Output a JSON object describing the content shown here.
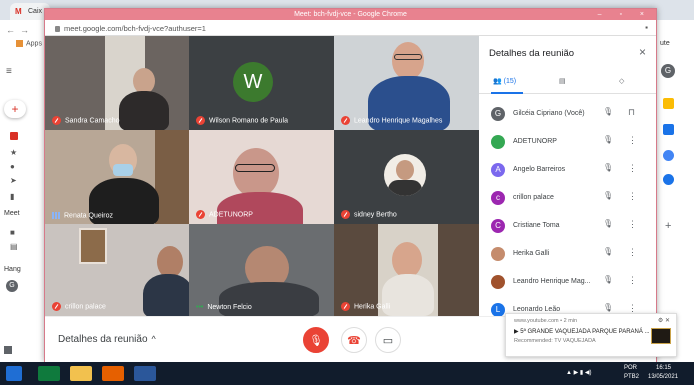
{
  "browser_bg": {
    "tab_label": "Caix",
    "apps_label": "Apps"
  },
  "window": {
    "title": "Meet: bch-fvdj-vce - Google Chrome",
    "url": "meet.google.com/bch-fvdj-vce?authuser=1",
    "controls": "– ▫ ×"
  },
  "tiles": [
    {
      "name": "Sandra Camacho",
      "status": "muted"
    },
    {
      "name": "Wilson Romano de Paula",
      "status": "muted",
      "avatar_letter": "W"
    },
    {
      "name": "Leandro Henrique Magalhes",
      "status": "muted"
    },
    {
      "name": "Renata Queiroz",
      "status": "speaking"
    },
    {
      "name": "ADETUNORP",
      "status": "muted"
    },
    {
      "name": "sidney Bertho",
      "status": "muted"
    },
    {
      "name": "crillon palace",
      "status": "muted"
    },
    {
      "name": "Newton Felcio",
      "status": "dots"
    },
    {
      "name": "Herika Galli",
      "status": "muted"
    }
  ],
  "bottom_bar": {
    "details_label": "Detalhes da reunião",
    "details_chevron": "^"
  },
  "panel": {
    "title": "Detalhes da reunião",
    "close": "×",
    "people_count": "(15)",
    "participants": [
      {
        "name": "Gilcéia Cipriano (Você)",
        "avatar": "G",
        "color": "#5f6368"
      },
      {
        "name": "ADETUNORP",
        "avatar": "",
        "color": "#34a853"
      },
      {
        "name": "Angelo Barreiros",
        "avatar": "A",
        "color": "#7b68ee"
      },
      {
        "name": "crillon palace",
        "avatar": "c",
        "color": "#9c27b0"
      },
      {
        "name": "Cristiane Toma",
        "avatar": "C",
        "color": "#9c27b0"
      },
      {
        "name": "Herika Galli",
        "avatar": "",
        "color": "#c58c6d"
      },
      {
        "name": "Leandro Henrique Mag...",
        "avatar": "",
        "color": "#a0522d"
      },
      {
        "name": "Leonardo Leão",
        "avatar": "L",
        "color": "#1a73e8"
      }
    ]
  },
  "notification": {
    "source": "www.youtube.com • 2 min",
    "title": "▶ 5ª GRANDE VAQUEJADA PARQUE PARANÁ ...",
    "subtitle": "Recommended: TV VAQUEJADA",
    "controls": "⚙ ✕"
  },
  "taskbar": {
    "lang": "POR",
    "region": "PTB2",
    "time": "16:15",
    "date": "13/05/2021"
  },
  "outer_left": [
    "M",
    "P",
    "B",
    "F",
    "C",
    "E",
    "S",
    "Meet",
    "Hang",
    "Hangouts"
  ]
}
